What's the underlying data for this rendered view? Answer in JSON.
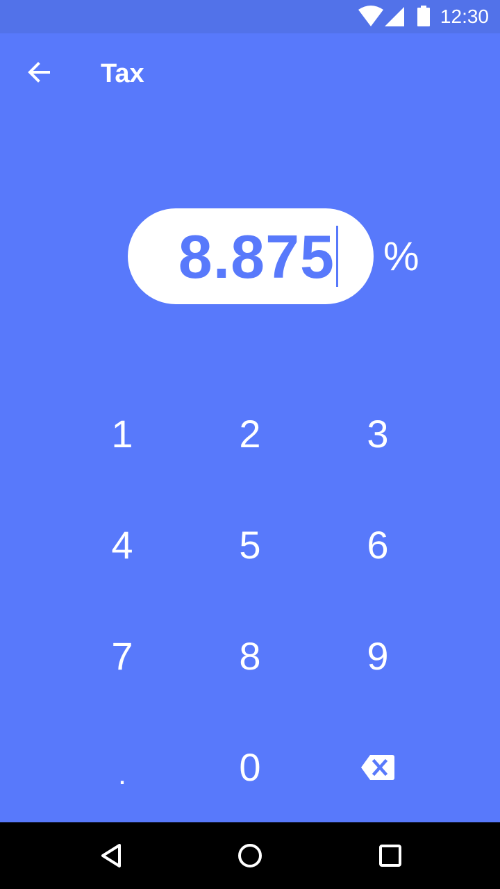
{
  "status_bar": {
    "time": "12:30",
    "icons": [
      "wifi-icon",
      "cell-signal-icon",
      "battery-icon"
    ]
  },
  "app_bar": {
    "back_icon": "arrow-left-icon",
    "title": "Tax"
  },
  "input": {
    "value": "8.875",
    "unit": "%"
  },
  "keypad": {
    "keys": [
      "1",
      "2",
      "3",
      "4",
      "5",
      "6",
      "7",
      "8",
      "9",
      ".",
      "0",
      "backspace-icon"
    ]
  },
  "nav_bar": {
    "icons": [
      "back-triangle-icon",
      "home-circle-icon",
      "recents-square-icon"
    ]
  },
  "colors": {
    "background": "#5879fb",
    "status_bar": "#5272e9",
    "text": "#ffffff",
    "nav_bar": "#000000"
  }
}
